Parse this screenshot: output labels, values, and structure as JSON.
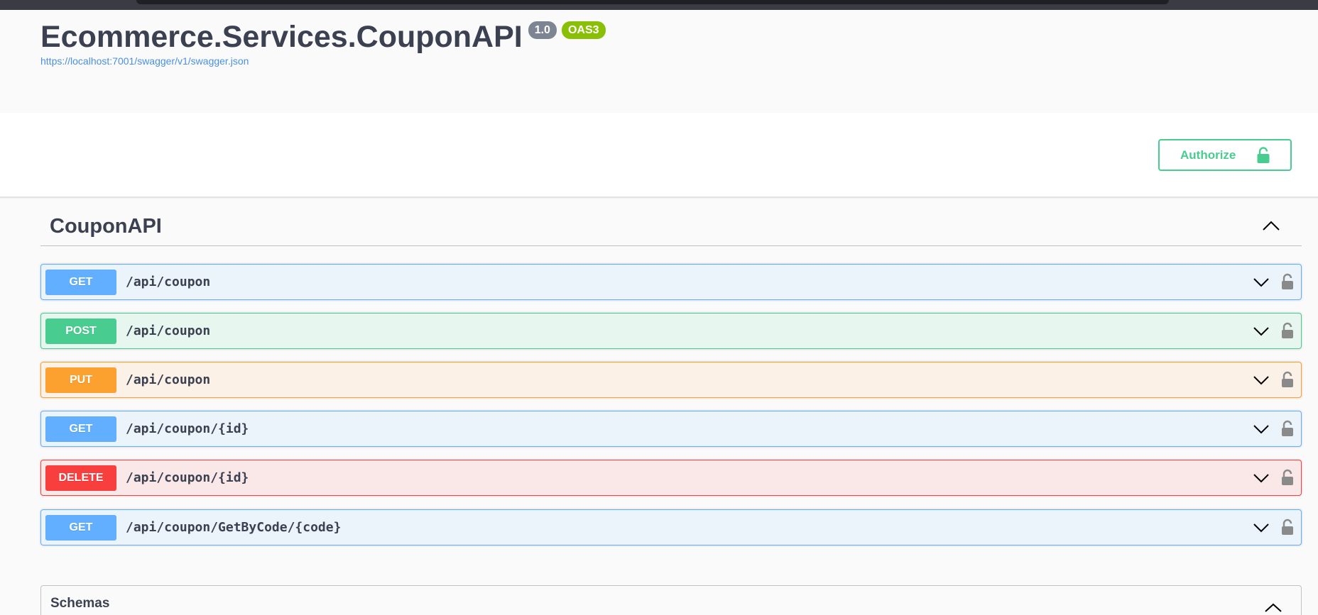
{
  "info": {
    "title": "Ecommerce.Services.CouponAPI",
    "version": "1.0",
    "oas_badge": "OAS3",
    "spec_url": "https://localhost:7001/swagger/v1/swagger.json"
  },
  "auth": {
    "authorize_label": "Authorize"
  },
  "tag": {
    "name": "CouponAPI"
  },
  "operations": [
    {
      "method": "GET",
      "path": "/api/coupon",
      "color": "#61affe",
      "bg": "#ebf3fb",
      "border": "#61affe"
    },
    {
      "method": "POST",
      "path": "/api/coupon",
      "color": "#49cc90",
      "bg": "#e8f6f0",
      "border": "#49cc90"
    },
    {
      "method": "PUT",
      "path": "/api/coupon",
      "color": "#fca130",
      "bg": "#fbf1e6",
      "border": "#fca130"
    },
    {
      "method": "GET",
      "path": "/api/coupon/{id}",
      "color": "#61affe",
      "bg": "#ebf3fb",
      "border": "#61affe"
    },
    {
      "method": "DELETE",
      "path": "/api/coupon/{id}",
      "color": "#f93e3e",
      "bg": "#fae7e7",
      "border": "#f93e3e"
    },
    {
      "method": "GET",
      "path": "/api/coupon/GetByCode/{code}",
      "color": "#61affe",
      "bg": "#ebf3fb",
      "border": "#61affe"
    }
  ],
  "schemas": {
    "title": "Schemas"
  },
  "icons": {
    "authorize": "unlock-icon",
    "operation_lock": "lock-icon",
    "expand": "chevron-down-icon",
    "collapse": "chevron-up-icon"
  }
}
